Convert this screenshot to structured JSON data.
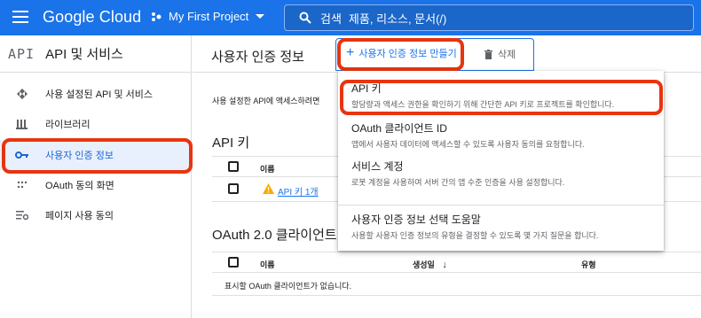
{
  "header": {
    "brand": "Google Cloud",
    "project": "My First Project",
    "search_label": "검색",
    "search_hint": "제품, 리소스, 문서(/)"
  },
  "sidebar": {
    "logo": "API",
    "title": "API 및 서비스",
    "items": [
      {
        "label": "사용 설정된 API 및 서비스",
        "icon": "enabled-apis-icon",
        "active": false
      },
      {
        "label": "라이브러리",
        "icon": "library-icon",
        "active": false
      },
      {
        "label": "사용자 인증 정보",
        "icon": "key-icon",
        "active": true
      },
      {
        "label": "OAuth 동의 화면",
        "icon": "consent-icon",
        "active": false
      },
      {
        "label": "페이지 사용 동의",
        "icon": "page-usage-icon",
        "active": false
      }
    ]
  },
  "main": {
    "title": "사용자 인증 정보",
    "create_label": "사용자 인증 정보 만들기",
    "delete_label": "삭제",
    "intro": "사용 설정한 API에 액세스하려면",
    "api_keys": {
      "title": "API 키",
      "col_name": "이름",
      "rows": [
        {
          "name": "API 키 1개"
        }
      ]
    },
    "oauth": {
      "title": "OAuth 2.0 클라이언트",
      "col_name": "이름",
      "col_created": "생성일",
      "col_type": "유형",
      "empty": "표시할 OAuth 클라이언트가 없습니다."
    }
  },
  "menu": {
    "items": [
      {
        "title": "API 키",
        "desc": "할당량과 액세스 권한을 확인하기 위해 간단한 API 키로 프로젝트를 확인합니다."
      },
      {
        "title": "OAuth 클라이언트 ID",
        "desc": "앱에서 사용자 데이터에 액세스할 수 있도록 사용자 동의를 요청합니다."
      },
      {
        "title": "서비스 계정",
        "desc": "로봇 계정을 사용하여 서버 간의 앱 수준 인증을 사용 설정합니다."
      },
      {
        "title": "사용자 인증 정보 선택 도움말",
        "desc": "사용할 사용자 인증 정보의 유형을 결정할 수 있도록 몇 가지 질문을 합니다."
      }
    ]
  },
  "colors": {
    "brand_blue": "#1a73e8",
    "highlight_red": "#e8340f",
    "warning": "#f9ab00"
  }
}
